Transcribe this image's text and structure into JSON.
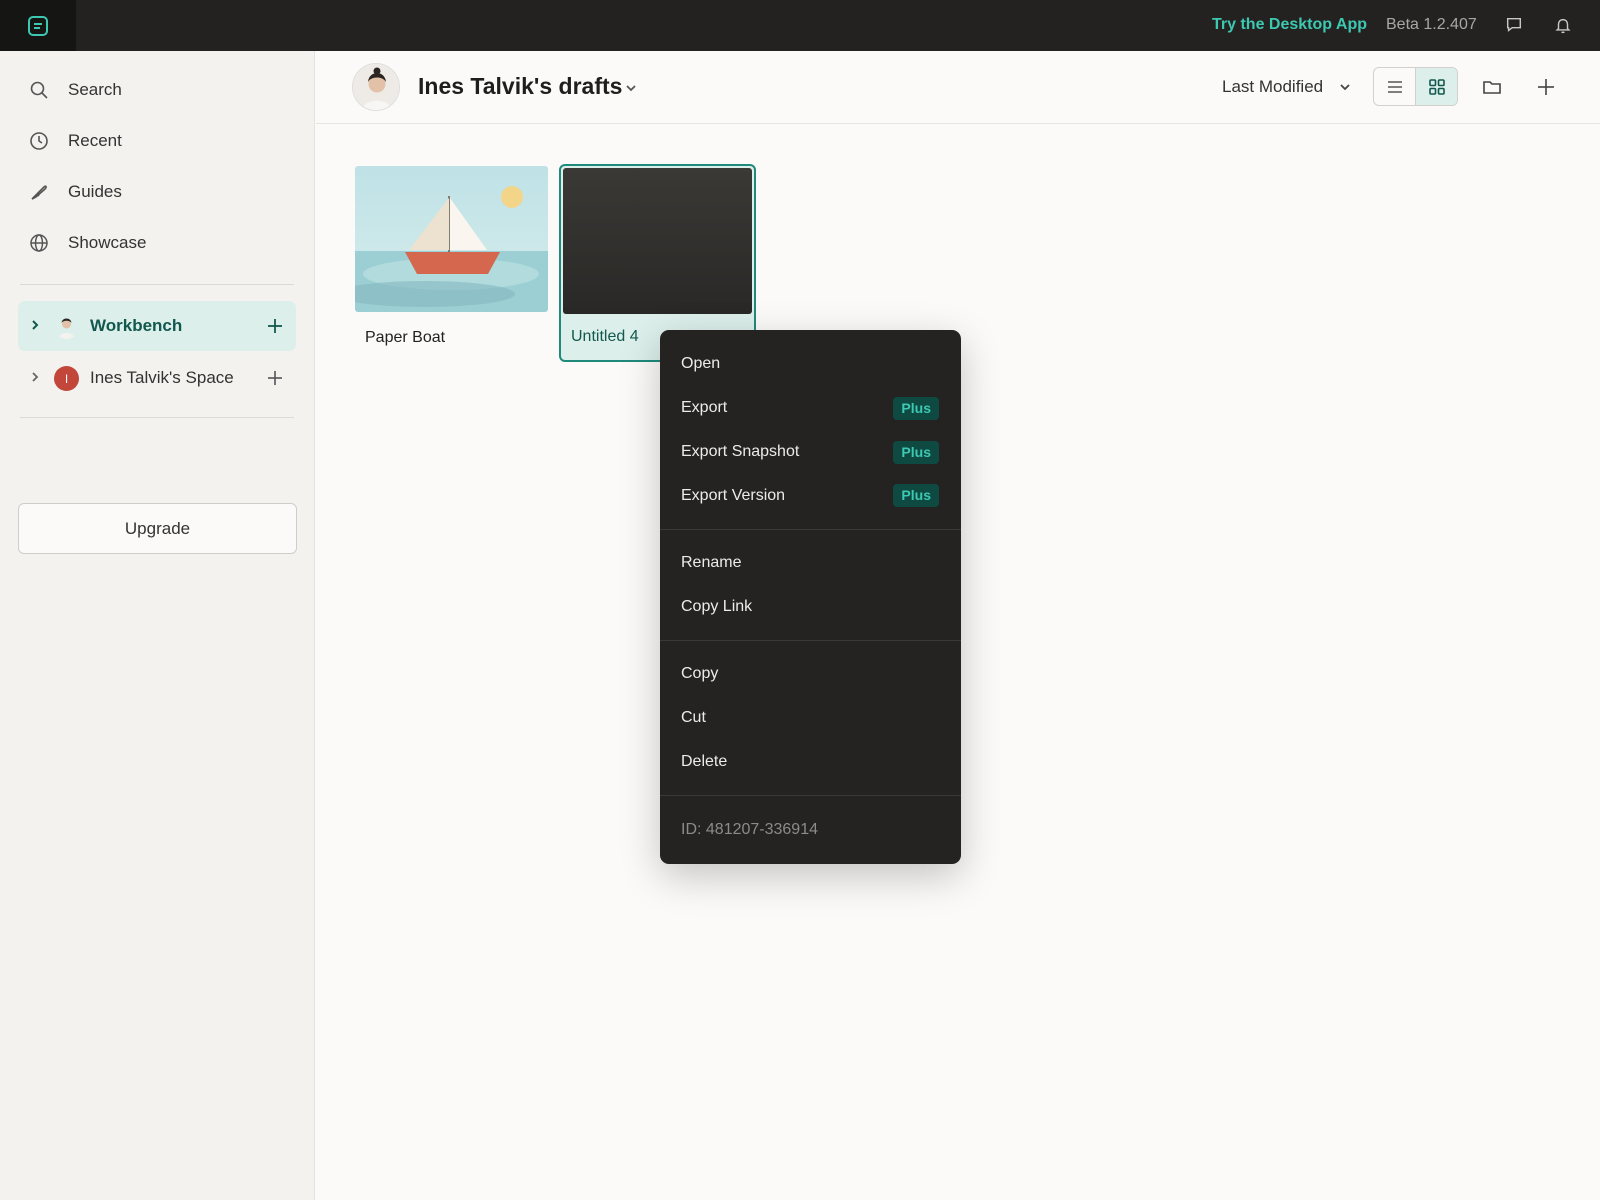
{
  "topbar": {
    "desktop_link": "Try the Desktop App",
    "version": "Beta 1.2.407",
    "icons": [
      "app-logo-icon",
      "feedback-icon",
      "bell-icon"
    ]
  },
  "sidebar": {
    "nav": [
      {
        "label": "Search",
        "icon": "search-icon"
      },
      {
        "label": "Recent",
        "icon": "clock-icon"
      },
      {
        "label": "Guides",
        "icon": "quill-icon"
      },
      {
        "label": "Showcase",
        "icon": "globe-icon"
      }
    ],
    "spaces": [
      {
        "name": "Workbench",
        "active": true,
        "avatar": "photo"
      },
      {
        "name": "Ines Talvik's Space",
        "active": false,
        "avatar_initial": "I"
      }
    ],
    "upgrade_label": "Upgrade"
  },
  "header": {
    "title": "Ines Talvik's drafts",
    "sort_label": "Last Modified",
    "view": "grid"
  },
  "files": [
    {
      "name": "Paper Boat",
      "selected": false
    },
    {
      "name": "Untitled 4",
      "selected": true
    }
  ],
  "context_menu": {
    "items": [
      {
        "label": "Open"
      },
      {
        "label": "Export",
        "badge": "Plus"
      },
      {
        "label": "Export Snapshot",
        "badge": "Plus"
      },
      {
        "label": "Export Version",
        "badge": "Plus"
      },
      {
        "label": "Rename"
      },
      {
        "label": "Copy Link"
      },
      {
        "label": "Copy"
      },
      {
        "label": "Cut"
      },
      {
        "label": "Delete"
      }
    ],
    "id_text": "ID: 481207-336914"
  },
  "colors": {
    "accent": "#3dc8b2",
    "accent_dark": "#13584e",
    "selected_bg": "#dcefeb",
    "topbar_bg": "#232221",
    "menu_bg": "#242321"
  }
}
